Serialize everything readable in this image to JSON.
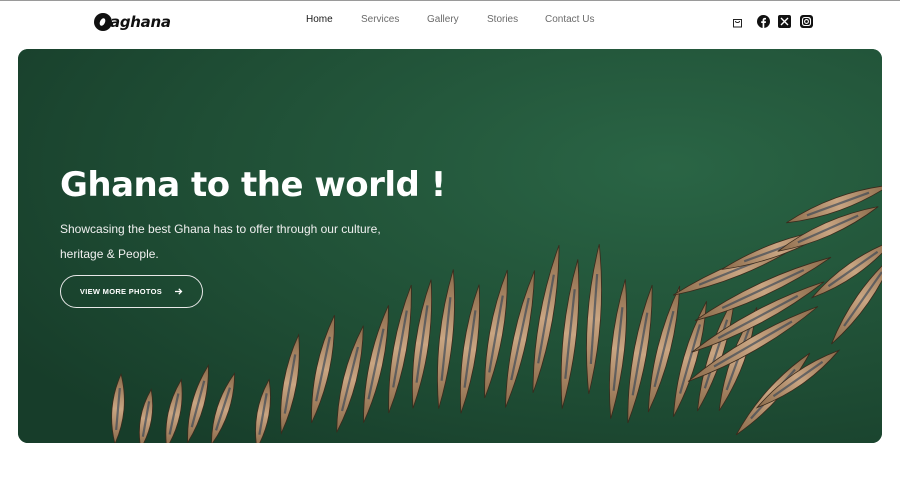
{
  "brand": {
    "name": "aghana"
  },
  "nav": {
    "items": [
      {
        "label": "Home",
        "active": true
      },
      {
        "label": "Services",
        "active": false
      },
      {
        "label": "Gallery",
        "active": false
      },
      {
        "label": "Stories",
        "active": false
      },
      {
        "label": "Contact Us",
        "active": false
      }
    ]
  },
  "header_icons": [
    "cart-icon",
    "facebook-icon",
    "x-icon",
    "instagram-icon"
  ],
  "hero": {
    "title": "Ghana to the world !",
    "subtitle": "Showcasing the best Ghana has to offer through our culture, heritage & People.",
    "button_label": "VIEW MORE PHOTOS",
    "button_icon": "arrow-right-icon"
  },
  "colors": {
    "hero_bg": "#1f4e35",
    "text_dark": "#1a1a1a",
    "nav_text": "#6b6b6b"
  }
}
